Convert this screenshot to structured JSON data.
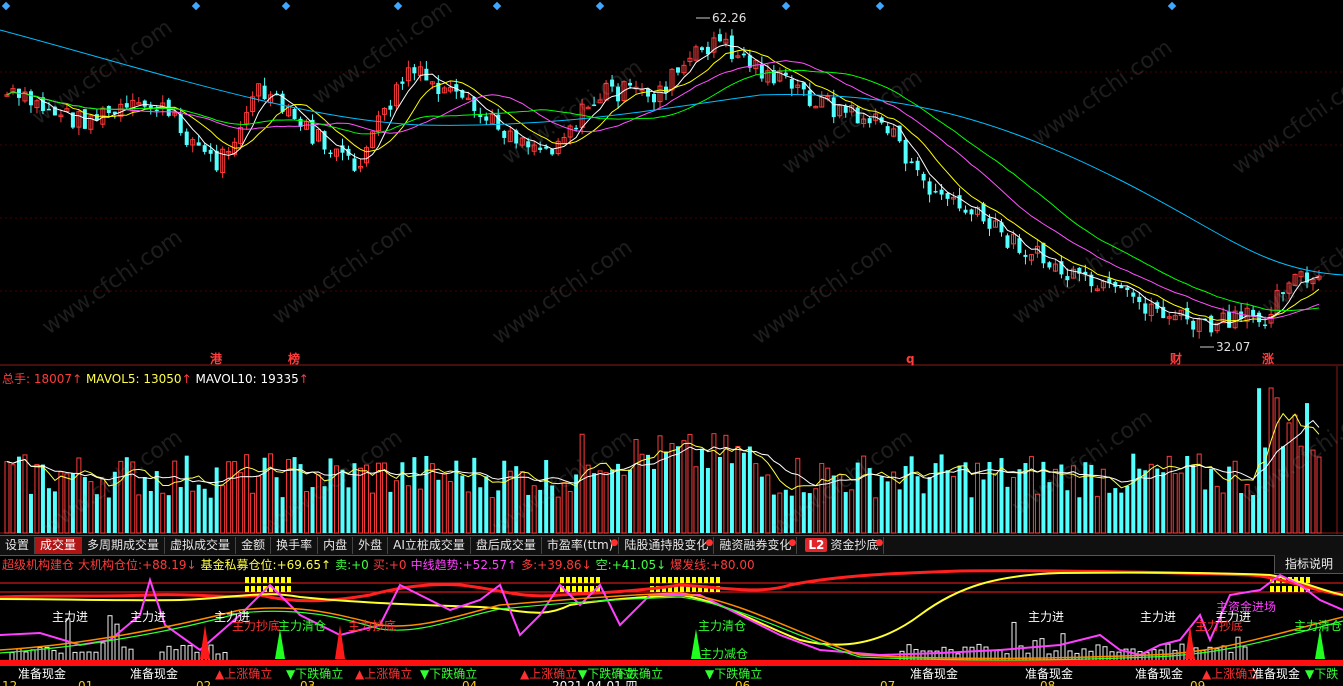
{
  "price_chart": {
    "high_label": "62.26",
    "low_label": "32.07",
    "event_markers": [
      "港",
      "榜",
      "q",
      "财",
      "涨"
    ]
  },
  "volume_legend": {
    "total_label": "总手:",
    "total_value": "18007",
    "mavol5_label": "MAVOL5:",
    "mavol5_value": "13050",
    "mavol10_label": "MAVOL10:",
    "mavol10_value": "19335",
    "arrow": "↑"
  },
  "tabs": [
    {
      "label": "设置",
      "active": false,
      "dot": false
    },
    {
      "label": "成交量",
      "active": true,
      "dot": false
    },
    {
      "label": "多周期成交量",
      "active": false,
      "dot": false
    },
    {
      "label": "虚拟成交量",
      "active": false,
      "dot": false
    },
    {
      "label": "金额",
      "active": false,
      "dot": false
    },
    {
      "label": "换手率",
      "active": false,
      "dot": false
    },
    {
      "label": "内盘",
      "active": false,
      "dot": false
    },
    {
      "label": "外盘",
      "active": false,
      "dot": false
    },
    {
      "label": "AI立桩成交量",
      "active": false,
      "dot": false
    },
    {
      "label": "盘后成交量",
      "active": false,
      "dot": false
    },
    {
      "label": "市盈率(ttm)",
      "active": false,
      "dot": true
    },
    {
      "label": "陆股通持股变化",
      "active": false,
      "dot": true
    },
    {
      "label": "融资融券变化",
      "active": false,
      "dot": true
    },
    {
      "label": "资金抄底",
      "active": false,
      "dot": true,
      "badge": "L2"
    }
  ],
  "indicator": {
    "name": "超级机构建仓",
    "items": [
      {
        "label": "大机构仓位:",
        "value": "+88.19",
        "arrow": "↓",
        "color": "#ff3b3b"
      },
      {
        "label": "基金私募仓位:",
        "value": "+69.65",
        "arrow": "↑",
        "color": "#ffff44"
      },
      {
        "label": "卖:",
        "value": "+0",
        "arrow": "",
        "color": "#40ff40"
      },
      {
        "label": "买:",
        "value": "+0",
        "arrow": "",
        "color": "#ff3b3b"
      },
      {
        "label": "中线趋势:",
        "value": "+52.57",
        "arrow": "↑",
        "color": "#ff40ff"
      },
      {
        "label": "多:",
        "value": "+39.86",
        "arrow": "↓",
        "color": "#ff3b3b"
      },
      {
        "label": "空:",
        "value": "+41.05",
        "arrow": "↓",
        "color": "#40ff40"
      },
      {
        "label": "爆发线:",
        "value": "+80.00",
        "arrow": "",
        "color": "#ff3b3b"
      }
    ],
    "help_label": "指标说明",
    "white_labels": [
      "主力进",
      "主力进",
      "主力进",
      "主力进",
      "主力进",
      "主力进"
    ],
    "green_labels": [
      "主力清仓",
      "主力清仓",
      "主力清仓",
      "主力减仓"
    ],
    "red_labels": [
      "主力抄底",
      "主力抄底",
      "主力抄底"
    ],
    "magenta_labels": [
      "主资金进场"
    ],
    "bottom_labels": [
      "准备现金",
      "准备现金",
      "▲上涨确立",
      "▼下跌确立",
      "▲上涨确立",
      "▼下跌确立",
      "▲上涨确立",
      "▼下跌确立",
      "下跌确立",
      "▼下跌确立",
      "准备现金",
      "准备现金",
      "准备现金",
      "▲上涨确立",
      "准备现金",
      "▼下跌"
    ],
    "date_labels": [
      "12",
      "01",
      "02",
      "03",
      "04",
      "2021-04-01,四",
      "06",
      "07",
      "08",
      "09"
    ]
  },
  "watermark_text": "www.cfchi.com",
  "colors": {
    "up": "#ff3b3b",
    "down": "#54ffff",
    "ma5": "#ffffff",
    "ma10": "#ffff00",
    "ma20": "#ff50ff",
    "ma30": "#00ff00",
    "ma60": "#00bfff"
  }
}
